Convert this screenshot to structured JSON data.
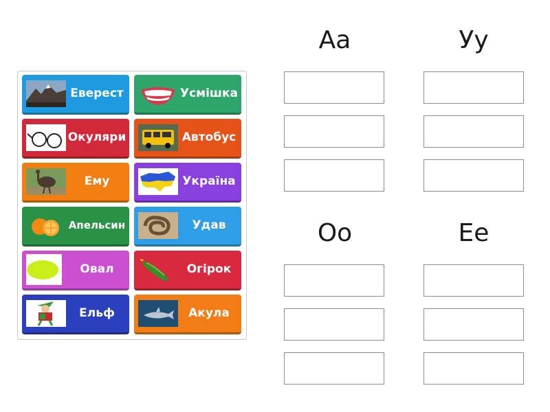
{
  "cards": [
    {
      "label": "Еверест",
      "color": "#1e9be0",
      "icon": "mountain-image"
    },
    {
      "label": "Усмішка",
      "color": "#2ea66b",
      "icon": "smile-image"
    },
    {
      "label": "Окуляри",
      "color": "#d1283a",
      "icon": "glasses-image"
    },
    {
      "label": "Автобус",
      "color": "#e65319",
      "icon": "bus-image"
    },
    {
      "label": "Ему",
      "color": "#f27d10",
      "icon": "emu-image"
    },
    {
      "label": "Україна",
      "color": "#8a3fe0",
      "icon": "ukraine-map-image"
    },
    {
      "label": "Апельсин",
      "color": "#2a9247",
      "icon": "orange-image"
    },
    {
      "label": "Удав",
      "color": "#2f9ee8",
      "icon": "snake-image"
    },
    {
      "label": "Овал",
      "color": "#cc4fd1",
      "icon": "oval-image"
    },
    {
      "label": "Огірок",
      "color": "#d9293e",
      "icon": "cucumber-image"
    },
    {
      "label": "Ельф",
      "color": "#2b3fbf",
      "icon": "elf-image"
    },
    {
      "label": "Акула",
      "color": "#f27d14",
      "icon": "shark-image"
    }
  ],
  "groups": [
    {
      "title": "Аа"
    },
    {
      "title": "Уу"
    },
    {
      "title": "Оо"
    },
    {
      "title": "Ее"
    }
  ]
}
